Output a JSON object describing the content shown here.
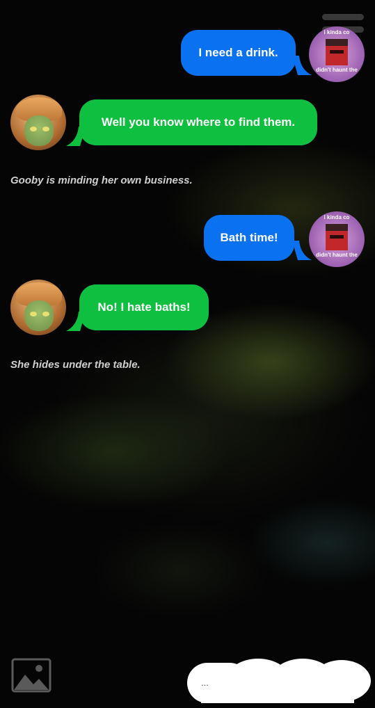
{
  "messages": [
    {
      "sender": "user",
      "text": "I need a drink."
    },
    {
      "sender": "character",
      "text": "Well you know where to find them."
    },
    {
      "type": "narration",
      "text": "Gooby is minding her own business."
    },
    {
      "sender": "user",
      "text": "Bath time!"
    },
    {
      "sender": "character",
      "text": "No! I hate baths!"
    },
    {
      "type": "narration",
      "text": "She hides under the table."
    }
  ],
  "user_avatar": {
    "caption_top": "i kinda co",
    "caption_bottom": "didn't haunt the"
  },
  "composer": {
    "placeholder": "..."
  },
  "colors": {
    "user_bubble": "#0a72f0",
    "character_bubble": "#0fbf3f",
    "narration_text": "#cfcfcf",
    "background": "#050505"
  },
  "icons": {
    "menu": "hamburger-icon",
    "attach_image": "image-icon"
  }
}
